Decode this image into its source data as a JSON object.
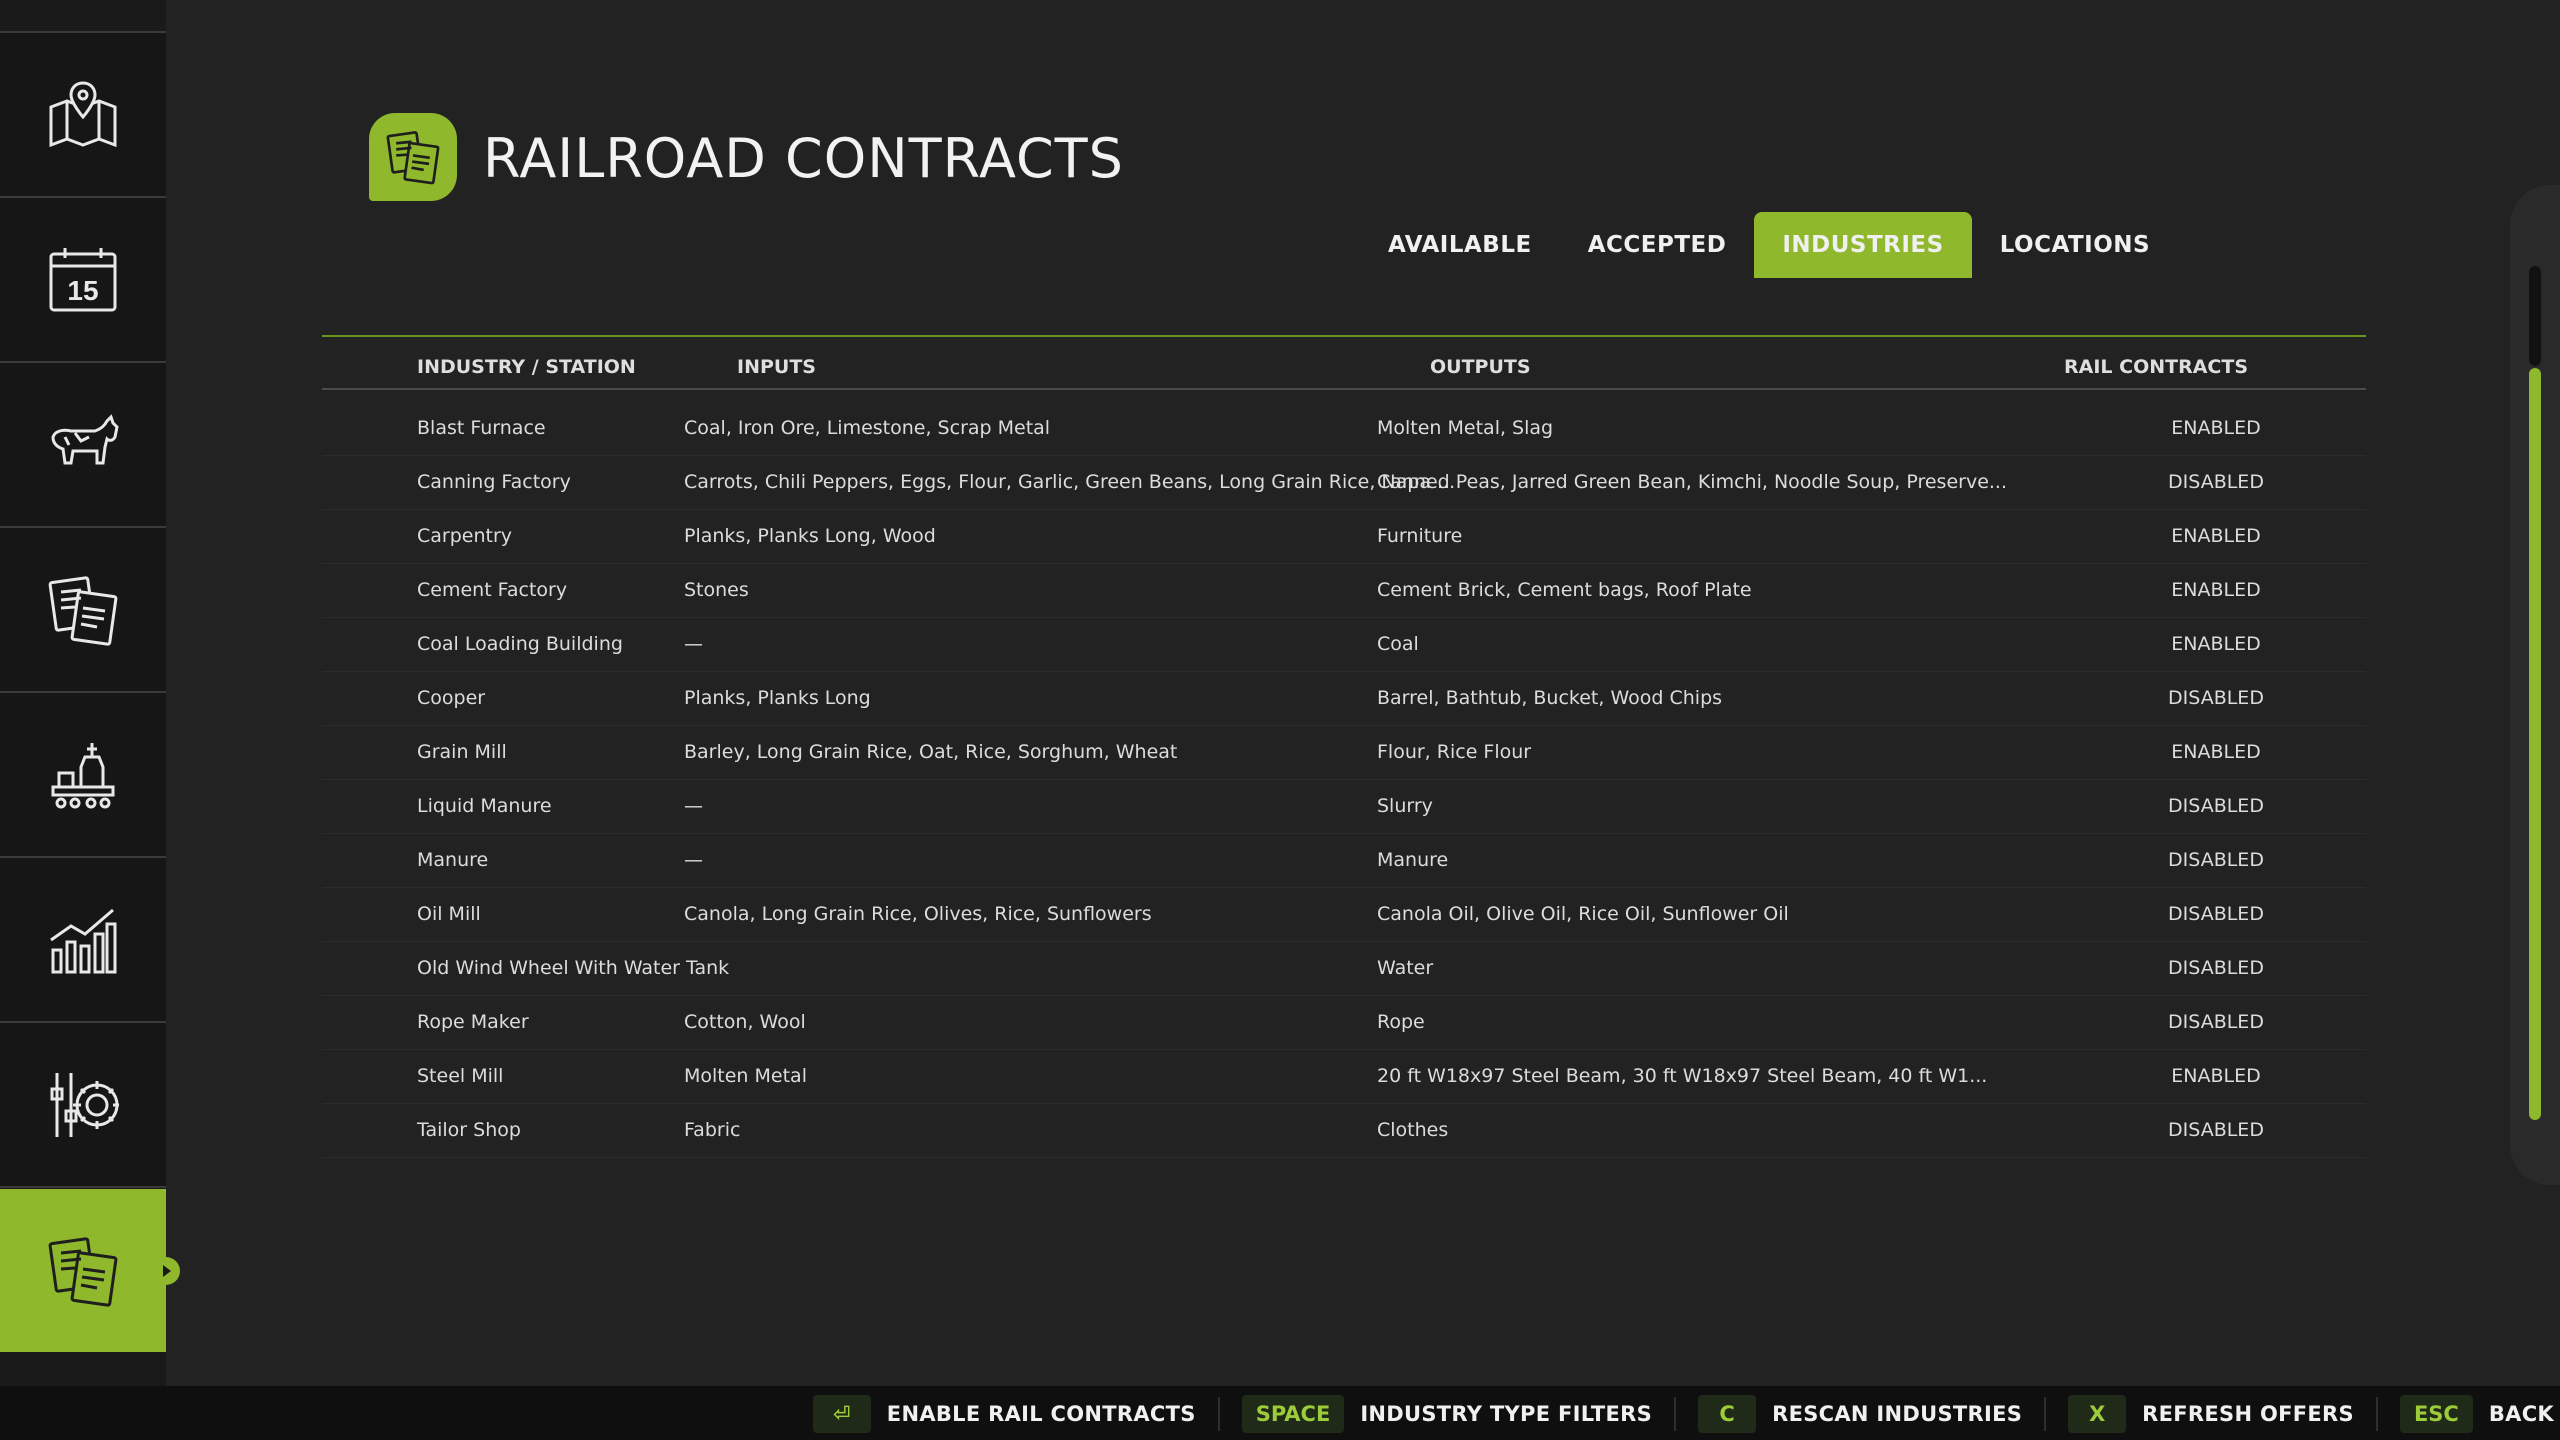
{
  "header": {
    "title": "RAILROAD CONTRACTS"
  },
  "tabs": [
    {
      "label": "AVAILABLE",
      "active": false
    },
    {
      "label": "ACCEPTED",
      "active": false
    },
    {
      "label": "INDUSTRIES",
      "active": true
    },
    {
      "label": "LOCATIONS",
      "active": false
    }
  ],
  "table": {
    "headers": {
      "name": "INDUSTRY / STATION",
      "inputs": "INPUTS",
      "outputs": "OUTPUTS",
      "rail": "RAIL CONTRACTS"
    },
    "rows": [
      {
        "name": "Blast Furnace",
        "inputs": "Coal, Iron Ore, Limestone, Scrap Metal",
        "outputs": "Molten Metal, Slag",
        "rail": "ENABLED"
      },
      {
        "name": "Canning Factory",
        "inputs": "Carrots, Chili Peppers, Eggs, Flour, Garlic, Green Beans, Long Grain Rice, Napa ...",
        "outputs": "Canned Peas, Jarred Green Bean, Kimchi, Noodle Soup, Preserve...",
        "rail": "DISABLED"
      },
      {
        "name": "Carpentry",
        "inputs": "Planks, Planks Long, Wood",
        "outputs": "Furniture",
        "rail": "ENABLED"
      },
      {
        "name": "Cement Factory",
        "inputs": "Stones",
        "outputs": "Cement Brick, Cement bags, Roof Plate",
        "rail": "ENABLED"
      },
      {
        "name": "Coal Loading Building",
        "inputs": "—",
        "outputs": "Coal",
        "rail": "ENABLED"
      },
      {
        "name": "Cooper",
        "inputs": "Planks, Planks Long",
        "outputs": "Barrel, Bathtub, Bucket, Wood Chips",
        "rail": "DISABLED"
      },
      {
        "name": "Grain Mill",
        "inputs": "Barley, Long Grain Rice, Oat, Rice, Sorghum, Wheat",
        "outputs": "Flour, Rice Flour",
        "rail": "ENABLED"
      },
      {
        "name": "Liquid Manure",
        "inputs": "—",
        "outputs": "Slurry",
        "rail": "DISABLED"
      },
      {
        "name": "Manure",
        "inputs": "—",
        "outputs": "Manure",
        "rail": "DISABLED"
      },
      {
        "name": "Oil Mill",
        "inputs": "Canola, Long Grain Rice, Olives, Rice, Sunflowers",
        "outputs": "Canola Oil, Olive Oil, Rice Oil, Sunflower Oil",
        "rail": "DISABLED"
      },
      {
        "name": "Old Wind Wheel With Water Tank",
        "inputs": "",
        "outputs": "Water",
        "rail": "DISABLED"
      },
      {
        "name": "Rope Maker",
        "inputs": "Cotton, Wool",
        "outputs": "Rope",
        "rail": "DISABLED"
      },
      {
        "name": "Steel Mill",
        "inputs": "Molten Metal",
        "outputs": "20 ft W18x97 Steel Beam, 30 ft W18x97 Steel Beam, 40 ft W1...",
        "rail": "ENABLED"
      },
      {
        "name": "Tailor Shop",
        "inputs": "Fabric",
        "outputs": "Clothes",
        "rail": "DISABLED"
      }
    ]
  },
  "actions": [
    {
      "key": "⏎",
      "label": "ENABLE RAIL CONTRACTS"
    },
    {
      "key": "SPACE",
      "label": "INDUSTRY TYPE FILTERS"
    },
    {
      "key": "C",
      "label": "RESCAN INDUSTRIES"
    },
    {
      "key": "X",
      "label": "REFRESH OFFERS"
    },
    {
      "key": "ESC",
      "label": "BACK"
    }
  ],
  "colors": {
    "accent": "#8fb82c",
    "background": "#222222",
    "sidebar": "#161616"
  },
  "sidebar": {
    "items": [
      {
        "icon": "map-icon"
      },
      {
        "icon": "calendar-icon",
        "text": "15"
      },
      {
        "icon": "animals-icon"
      },
      {
        "icon": "contracts-icon"
      },
      {
        "icon": "production-icon"
      },
      {
        "icon": "statistics-icon"
      },
      {
        "icon": "settings-icon"
      },
      {
        "icon": "railroad-contracts-icon",
        "active": true
      }
    ]
  }
}
